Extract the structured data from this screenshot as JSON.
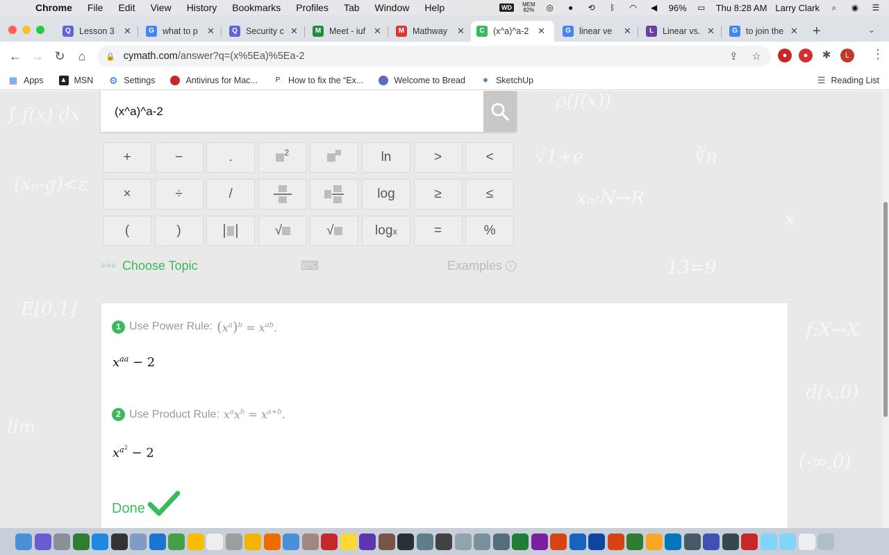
{
  "menubar": {
    "app": "Chrome",
    "items": [
      "File",
      "Edit",
      "View",
      "History",
      "Bookmarks",
      "Profiles",
      "Tab",
      "Window",
      "Help"
    ],
    "wd": "WD",
    "mem_label": "MEM",
    "mem_value": "82%",
    "battery": "96%",
    "clock": "Thu 8:28 AM",
    "user": "Larry Clark"
  },
  "tabs": [
    {
      "title": "Lesson 3",
      "color": "#5f63d6",
      "icon": "Q"
    },
    {
      "title": "what to p",
      "color": "#4285f4",
      "icon": "G"
    },
    {
      "title": "Security c",
      "color": "#5f63d6",
      "icon": "Q"
    },
    {
      "title": "Meet - iuf",
      "color": "#1e8e3e",
      "icon": "M"
    },
    {
      "title": "Mathway",
      "color": "#d93838",
      "icon": "M"
    },
    {
      "title": "(x^a)^a-2",
      "color": "#3cb95c",
      "icon": "C"
    },
    {
      "title": "linear ve",
      "color": "#4285f4",
      "icon": "G"
    },
    {
      "title": "Linear vs.",
      "color": "#6a3f9e",
      "icon": "L"
    },
    {
      "title": "to join the",
      "color": "#4285f4",
      "icon": "G"
    }
  ],
  "address": {
    "domain": "cymath.com",
    "path": "/answer?q=(x%5Ea)%5Ea-2"
  },
  "profile_initial": "L",
  "bookmarks": [
    {
      "label": "Apps",
      "color": "#4285f4"
    },
    {
      "label": "MSN",
      "color": "#222"
    },
    {
      "label": "Settings",
      "color": "#1a73e8"
    },
    {
      "label": "Antivirus for Mac...",
      "color": "#c62828"
    },
    {
      "label": "How to fix the “Ex...",
      "color": "#333"
    },
    {
      "label": "Welcome to Bread",
      "color": "#5c6bc0"
    },
    {
      "label": "SketchUp",
      "color": "#1565c0"
    }
  ],
  "reading_list": "Reading List",
  "search": {
    "value": "(x^a)^a-2"
  },
  "keypad": {
    "row1": [
      "+",
      "−",
      ".",
      "²",
      "",
      "ln",
      ">",
      "<"
    ],
    "row2": [
      "×",
      "÷",
      "/",
      "",
      "",
      "log",
      "≥",
      "≤"
    ],
    "row3": [
      "(",
      ")",
      "",
      "√",
      "√",
      "log",
      "=",
      "%"
    ],
    "log_sub": "x",
    "sup_two": "2"
  },
  "choose_topic": "Choose Topic",
  "examples": "Examples",
  "solution": {
    "step1_label": "Use Power Rule:",
    "step2_label": "Use Product Rule:",
    "done": "Done"
  },
  "colors": {
    "accent": "#3cb95c"
  }
}
